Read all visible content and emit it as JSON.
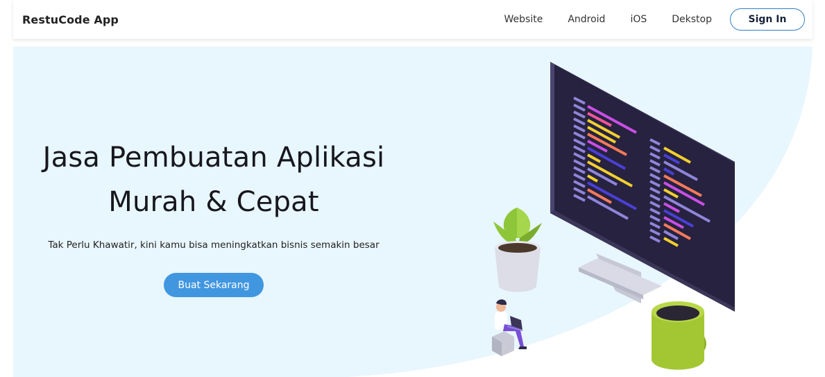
{
  "navbar": {
    "brand": "RestuCode App",
    "links": [
      {
        "label": "Website"
      },
      {
        "label": "Android"
      },
      {
        "label": "iOS"
      },
      {
        "label": "Dekstop"
      }
    ],
    "signin_label": "Sign In"
  },
  "hero": {
    "title_line1": "Jasa Pembuatan Aplikasi",
    "title_line2": "Murah & Cepat",
    "subtitle": "Tak Perlu Khawatir, kini kamu bisa meningkatkan bisnis semakin besar",
    "cta_label": "Buat Sekarang"
  },
  "colors": {
    "hero_background": "#e8f6fd",
    "cta": "#4196e0",
    "signin_border": "#2e7ec6",
    "monitor_screen": "#26223f",
    "mug": "#a3c733",
    "plant": "#8ec63a"
  },
  "illustration": {
    "icons": [
      "monitor-icon",
      "plant-pot-icon",
      "coffee-mug-icon",
      "person-laptop-icon"
    ]
  }
}
